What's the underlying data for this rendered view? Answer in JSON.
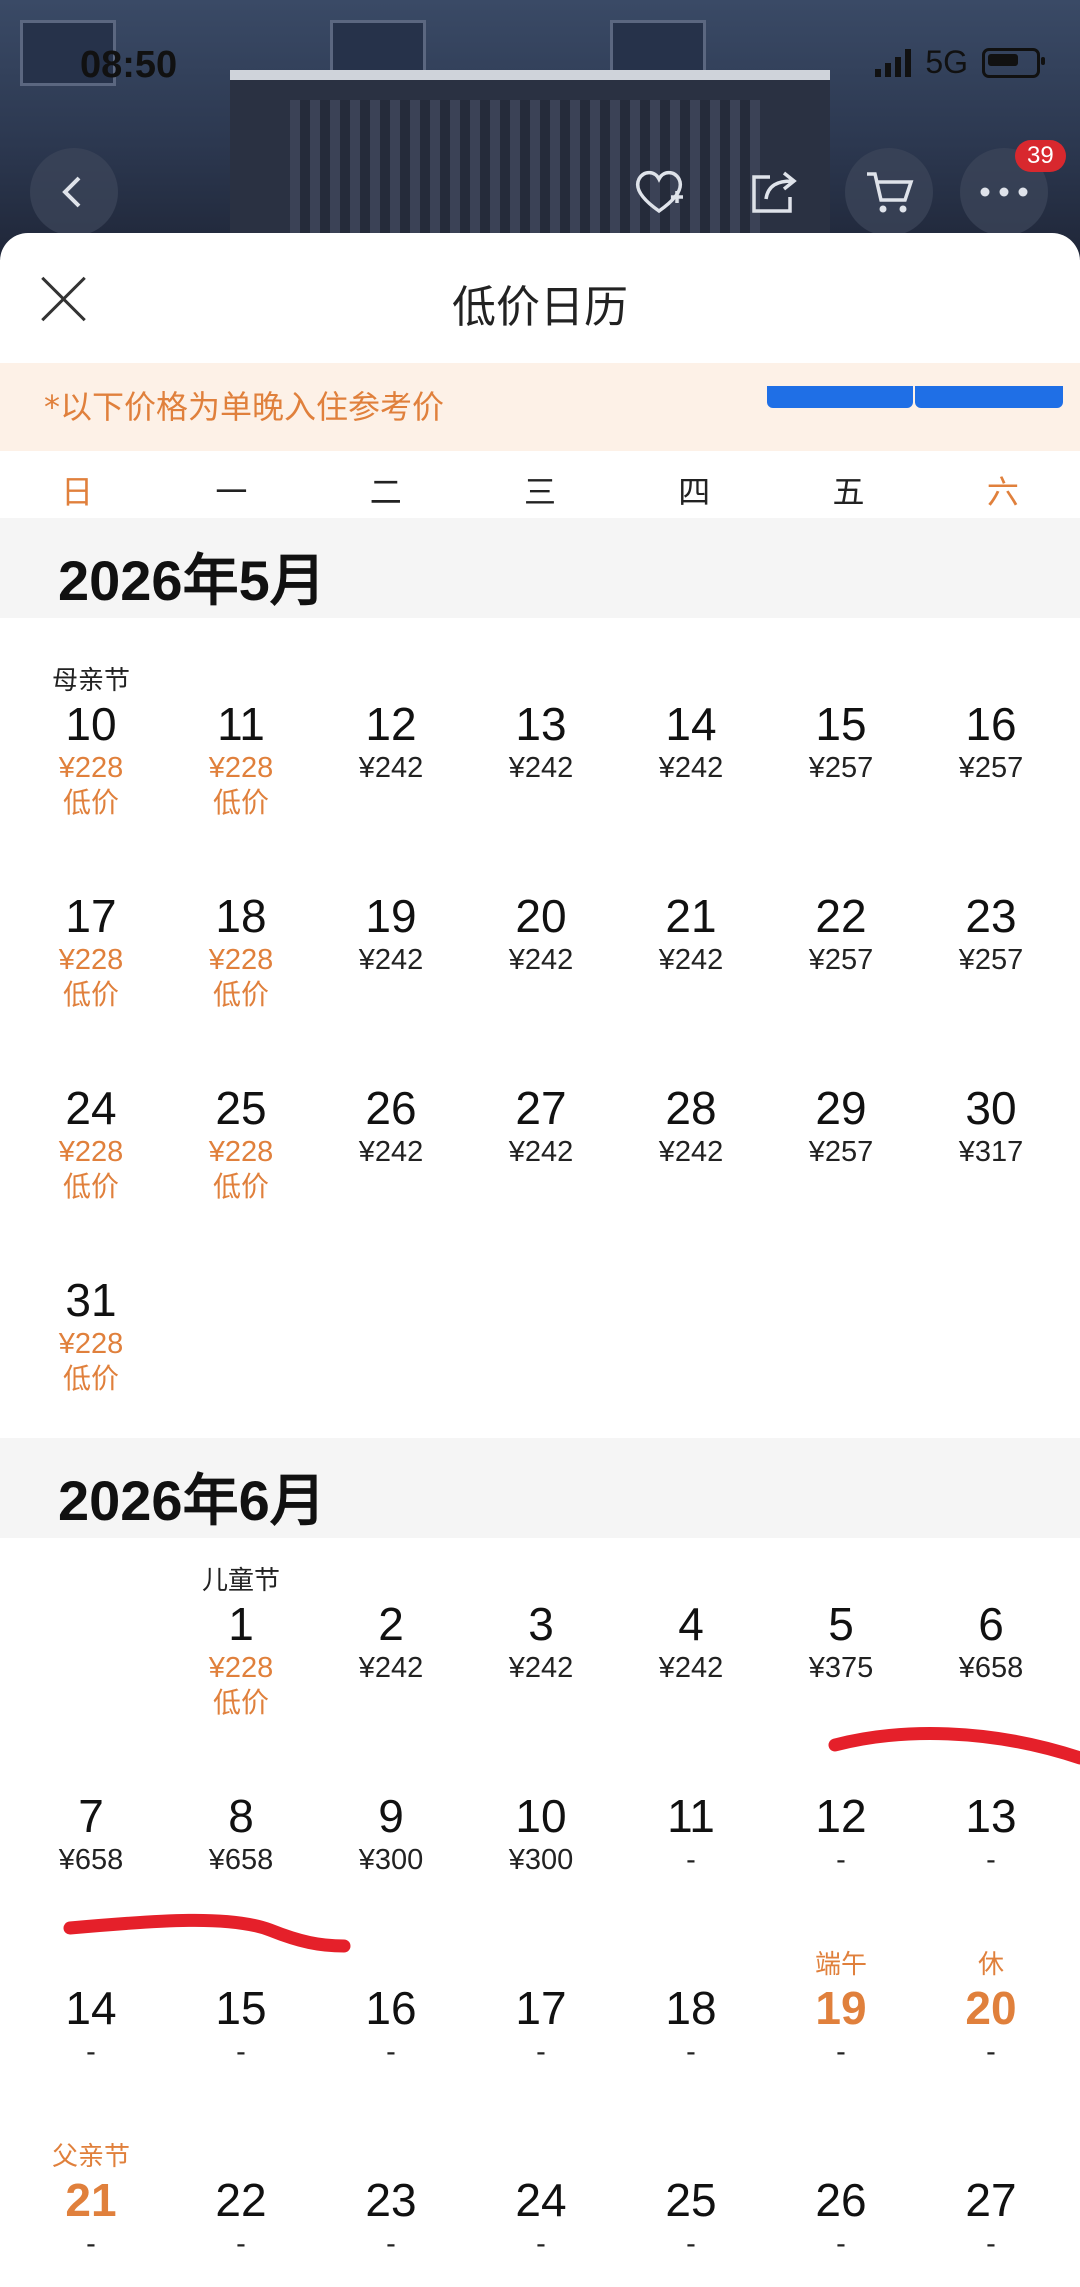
{
  "status": {
    "time": "08:50",
    "network": "5G"
  },
  "header": {
    "cart_badge": "39"
  },
  "sheet": {
    "title": "低价日历",
    "notice": "*以下价格为单晚入住参考价",
    "weekdays": [
      "日",
      "一",
      "二",
      "三",
      "四",
      "五",
      "六"
    ]
  },
  "months": [
    {
      "title": "2026年5月",
      "days": [
        {
          "day": "10",
          "price": "¥228",
          "tag": "低价",
          "holiday": "母亲节"
        },
        {
          "day": "11",
          "price": "¥228",
          "tag": "低价"
        },
        {
          "day": "12",
          "price": "¥242"
        },
        {
          "day": "13",
          "price": "¥242"
        },
        {
          "day": "14",
          "price": "¥242"
        },
        {
          "day": "15",
          "price": "¥257"
        },
        {
          "day": "16",
          "price": "¥257"
        },
        {
          "day": "17",
          "price": "¥228",
          "tag": "低价"
        },
        {
          "day": "18",
          "price": "¥228",
          "tag": "低价"
        },
        {
          "day": "19",
          "price": "¥242"
        },
        {
          "day": "20",
          "price": "¥242"
        },
        {
          "day": "21",
          "price": "¥242"
        },
        {
          "day": "22",
          "price": "¥257"
        },
        {
          "day": "23",
          "price": "¥257"
        },
        {
          "day": "24",
          "price": "¥228",
          "tag": "低价"
        },
        {
          "day": "25",
          "price": "¥228",
          "tag": "低价"
        },
        {
          "day": "26",
          "price": "¥242"
        },
        {
          "day": "27",
          "price": "¥242"
        },
        {
          "day": "28",
          "price": "¥242"
        },
        {
          "day": "29",
          "price": "¥257"
        },
        {
          "day": "30",
          "price": "¥317"
        },
        {
          "day": "31",
          "price": "¥228",
          "tag": "低价"
        }
      ]
    },
    {
      "title": "2026年6月",
      "days": [
        {
          "day": "1",
          "price": "¥228",
          "tag": "低价",
          "holiday": "儿童节"
        },
        {
          "day": "2",
          "price": "¥242"
        },
        {
          "day": "3",
          "price": "¥242"
        },
        {
          "day": "4",
          "price": "¥242"
        },
        {
          "day": "5",
          "price": "¥375"
        },
        {
          "day": "6",
          "price": "¥658"
        },
        {
          "day": "7",
          "price": "¥658"
        },
        {
          "day": "8",
          "price": "¥658"
        },
        {
          "day": "9",
          "price": "¥300"
        },
        {
          "day": "10",
          "price": "¥300"
        },
        {
          "day": "11",
          "price": "-"
        },
        {
          "day": "12",
          "price": "-"
        },
        {
          "day": "13",
          "price": "-"
        },
        {
          "day": "14",
          "price": "-"
        },
        {
          "day": "15",
          "price": "-"
        },
        {
          "day": "16",
          "price": "-"
        },
        {
          "day": "17",
          "price": "-"
        },
        {
          "day": "18",
          "price": "-"
        },
        {
          "day": "19",
          "price": "-",
          "holiday": "端午",
          "highlight": true
        },
        {
          "day": "20",
          "price": "-",
          "holiday": "休",
          "highlight": true
        },
        {
          "day": "21",
          "price": "-",
          "holiday": "父亲节",
          "highlight": true
        },
        {
          "day": "22",
          "price": "-"
        },
        {
          "day": "23",
          "price": "-"
        },
        {
          "day": "24",
          "price": "-"
        },
        {
          "day": "25",
          "price": "-"
        },
        {
          "day": "26",
          "price": "-"
        },
        {
          "day": "27",
          "price": "-"
        }
      ]
    }
  ],
  "colors": {
    "accent": "#e0803c",
    "annotation": "#e5202a",
    "tab_blue": "#1f6fe6"
  },
  "icons": [
    "back-icon",
    "favorite-icon",
    "share-icon",
    "cart-icon",
    "more-icon",
    "close-icon"
  ]
}
